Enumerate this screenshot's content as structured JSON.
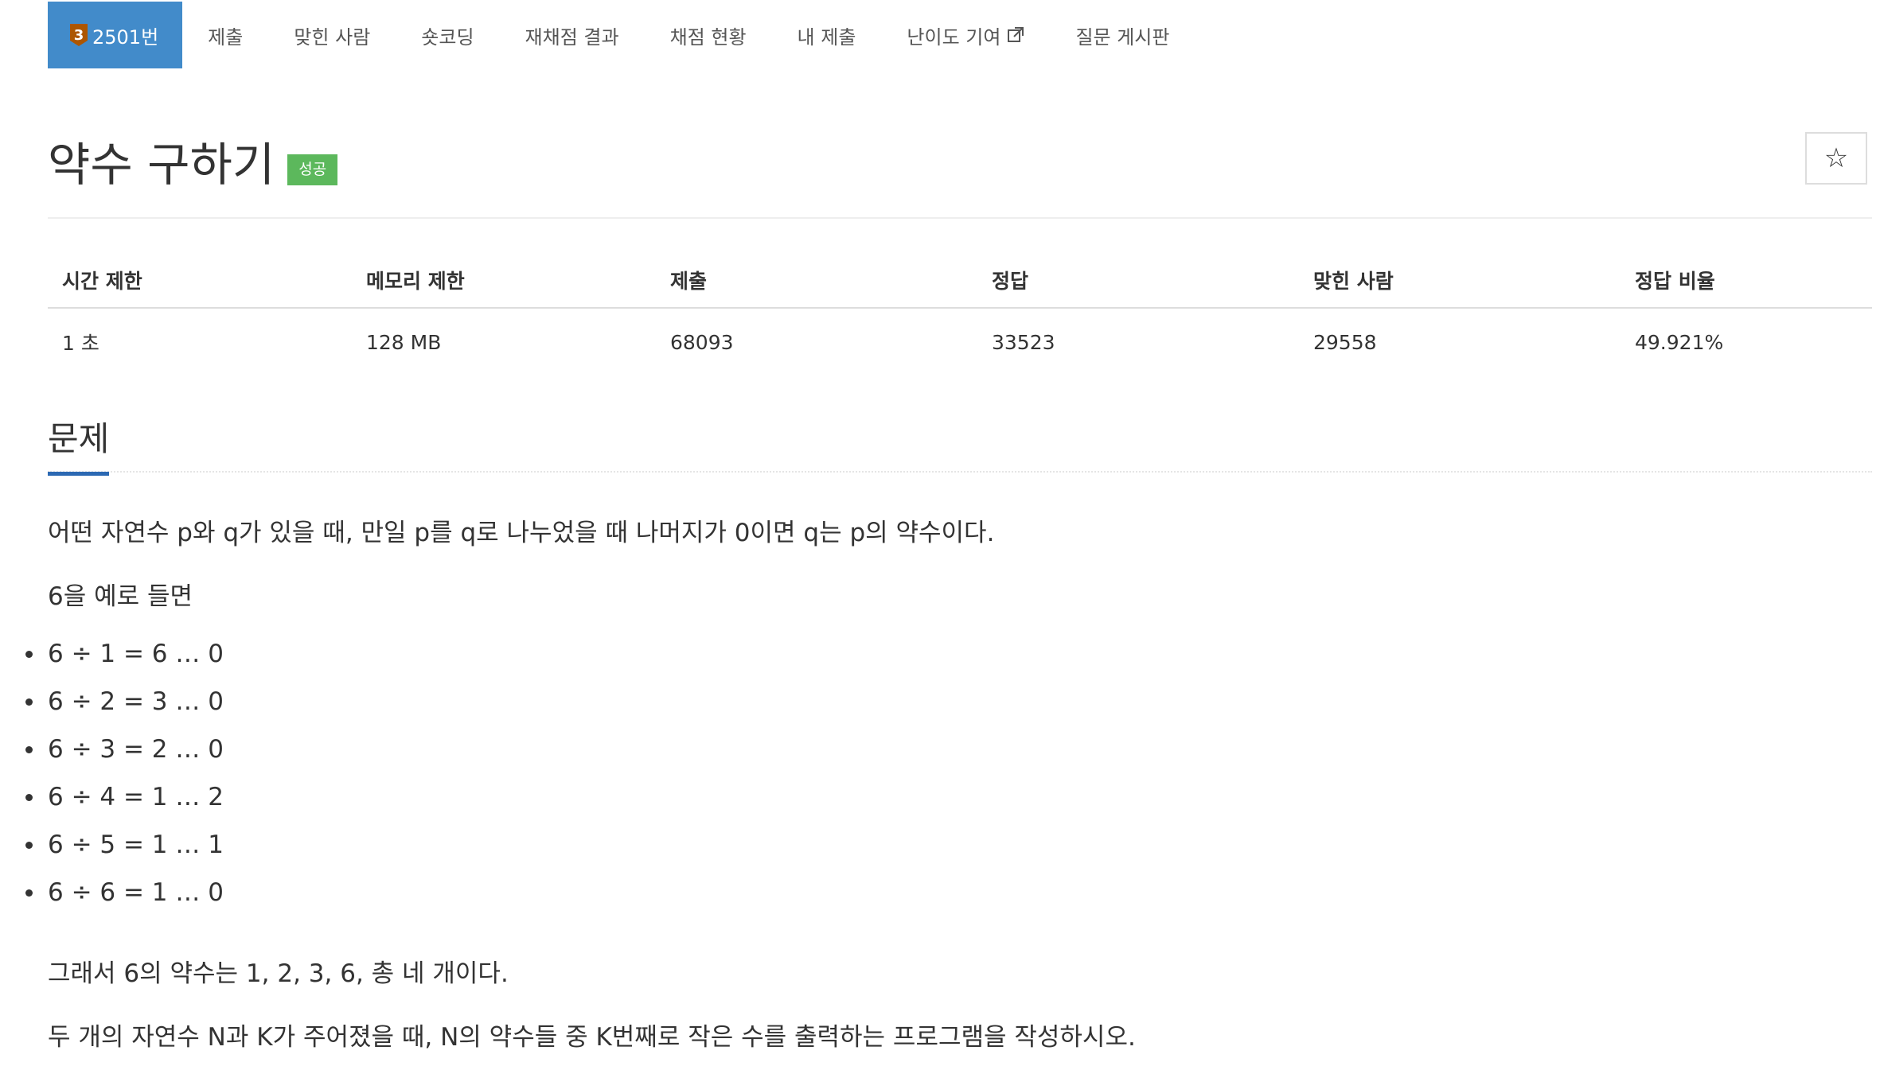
{
  "nav": {
    "problem_tier": "3",
    "problem_label": "2501번",
    "items": [
      "제출",
      "맞힌 사람",
      "숏코딩",
      "재채점 결과",
      "채점 현황",
      "내 제출",
      "난이도 기여",
      "질문 게시판"
    ]
  },
  "problem": {
    "title": "약수 구하기",
    "status_badge": "성공",
    "star_icon": "☆"
  },
  "info_table": {
    "headers": [
      "시간 제한",
      "메모리 제한",
      "제출",
      "정답",
      "맞힌 사람",
      "정답 비율"
    ],
    "values": [
      "1 초",
      "128 MB",
      "68093",
      "33523",
      "29558",
      "49.921%"
    ]
  },
  "section": {
    "title": "문제",
    "p1": "어떤 자연수 p와 q가 있을 때, 만일 p를 q로 나누었을 때 나머지가 0이면 q는 p의 약수이다.",
    "p2": "6을 예로 들면",
    "items": [
      "6 ÷ 1 = 6 … 0",
      "6 ÷ 2 = 3 … 0",
      "6 ÷ 3 = 2 … 0",
      "6 ÷ 4 = 1 … 2",
      "6 ÷ 5 = 1 … 1",
      "6 ÷ 6 = 1 … 0"
    ],
    "p3": "그래서 6의 약수는 1, 2, 3, 6, 총 네 개이다.",
    "p4": "두 개의 자연수 N과 K가 주어졌을 때, N의 약수들 중 K번째로 작은 수를 출력하는 프로그램을 작성하시오."
  },
  "colors": {
    "nav_active": "#428bca",
    "tier_bronze": "#ad5600",
    "success": "#5cb85c",
    "section_underline": "#2c69b3"
  }
}
